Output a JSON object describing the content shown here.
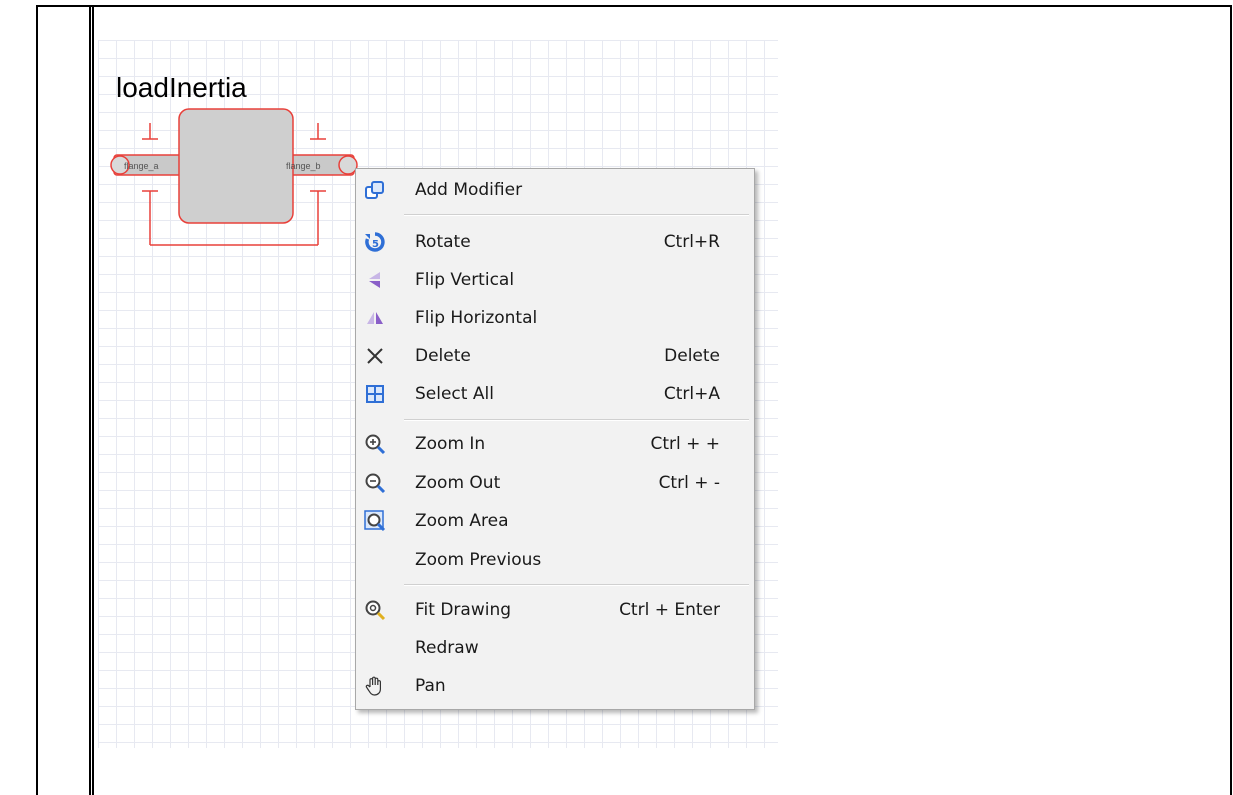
{
  "component": {
    "title": "loadInertia",
    "flange_a_label": "flange_a",
    "flange_b_label": "flange_b"
  },
  "context_menu": {
    "items": [
      {
        "label": "Add Modifier",
        "shortcut": "",
        "icon": "add-modifier-icon"
      },
      {
        "label": "Rotate",
        "shortcut": "Ctrl+R",
        "icon": "rotate-icon"
      },
      {
        "label": "Flip Vertical",
        "shortcut": "",
        "icon": "flip-vertical-icon"
      },
      {
        "label": "Flip Horizontal",
        "shortcut": "",
        "icon": "flip-horizontal-icon"
      },
      {
        "label": "Delete",
        "shortcut": "Delete",
        "icon": "delete-icon"
      },
      {
        "label": "Select All",
        "shortcut": "Ctrl+A",
        "icon": "select-all-icon"
      },
      {
        "label": "Zoom In",
        "shortcut": "Ctrl + +",
        "icon": "zoom-in-icon"
      },
      {
        "label": "Zoom Out",
        "shortcut": "Ctrl + -",
        "icon": "zoom-out-icon"
      },
      {
        "label": "Zoom Area",
        "shortcut": "",
        "icon": "zoom-area-icon"
      },
      {
        "label": "Zoom Previous",
        "shortcut": "",
        "icon": ""
      },
      {
        "label": "Fit Drawing",
        "shortcut": "Ctrl + Enter",
        "icon": "fit-drawing-icon"
      },
      {
        "label": "Redraw",
        "shortcut": "",
        "icon": ""
      },
      {
        "label": "Pan",
        "shortcut": "",
        "icon": "pan-hand-icon"
      }
    ]
  },
  "colors": {
    "component_outline": "#e8403a",
    "component_fill": "#cfcfcf",
    "menu_background": "#f2f2f2",
    "icon_blue": "#2f6fd6",
    "icon_purple": "#8a5fc8"
  }
}
